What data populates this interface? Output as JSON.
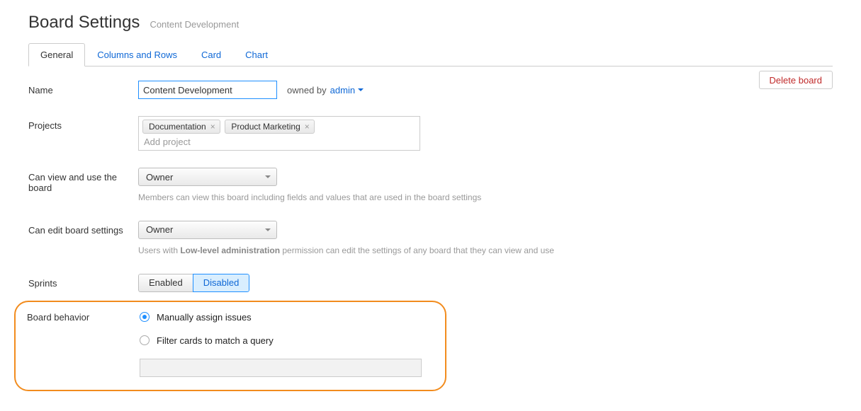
{
  "header": {
    "title": "Board Settings",
    "subtitle": "Content Development"
  },
  "tabs": {
    "general": "General",
    "columns": "Columns and Rows",
    "card": "Card",
    "chart": "Chart"
  },
  "actions": {
    "delete": "Delete board"
  },
  "name": {
    "label": "Name",
    "value": "Content Development",
    "owned_by_label": "owned by",
    "owner": "admin"
  },
  "projects": {
    "label": "Projects",
    "tags": [
      "Documentation",
      "Product Marketing"
    ],
    "placeholder": "Add project"
  },
  "view": {
    "label": "Can view and use the board",
    "value": "Owner",
    "help": "Members can view this board including fields and values that are used in the board settings"
  },
  "edit": {
    "label": "Can edit board settings",
    "value": "Owner",
    "help_prefix": "Users with ",
    "help_bold": "Low-level administration",
    "help_suffix": " permission can edit the settings of any board that they can view and use"
  },
  "sprints": {
    "label": "Sprints",
    "enabled": "Enabled",
    "disabled": "Disabled"
  },
  "behavior": {
    "label": "Board behavior",
    "opt1": "Manually assign issues",
    "opt2": "Filter cards to match a query"
  }
}
